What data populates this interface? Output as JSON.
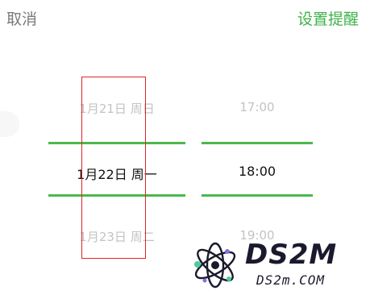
{
  "header": {
    "cancel_label": "取消",
    "confirm_label": "设置提醒"
  },
  "picker": {
    "date_items": [
      "1月21日 周日",
      "1月22日 周一",
      "1月23日 周二"
    ],
    "time_items": [
      "17:00",
      "18:00",
      "19:00"
    ],
    "selected_date": "1月22日 周一",
    "selected_time": "18:00"
  },
  "colors": {
    "accent_green": "#3db249",
    "selection_line": "#4bb84d",
    "highlight_box": "#e02424",
    "dim_text": "#c3c3c3",
    "cancel_text": "#7a7a7a"
  },
  "watermark": {
    "title": "DS2M",
    "subtitle": "DS2m.COM",
    "icon": "atom-logo-icon"
  }
}
